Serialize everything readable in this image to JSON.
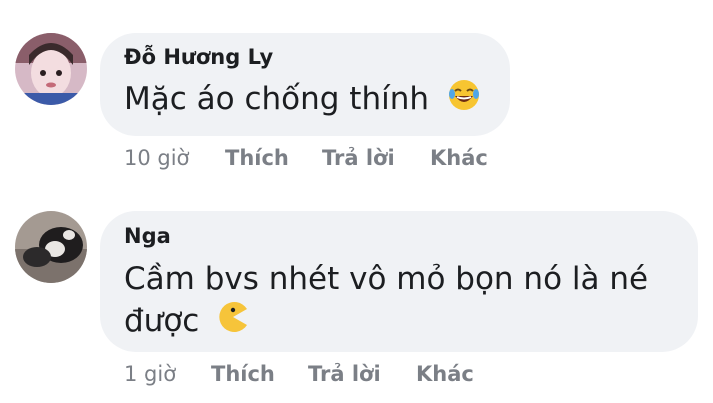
{
  "comments": [
    {
      "author": "Đỗ Hương Ly",
      "text": "Mặc áo chống thính",
      "emoji_icon": "laughing-tears-emoji",
      "time": "10 giờ",
      "like": "Thích",
      "reply": "Trả lời",
      "more": "Khác"
    },
    {
      "author": "Nga",
      "text_line1": "Cầm bvs nhét vô mỏ bọn nó là né",
      "text_line2": "được",
      "emoji_icon": "pacman-emoji",
      "time": "1 giờ",
      "like": "Thích",
      "reply": "Trả lời",
      "more": "Khác"
    }
  ],
  "colors": {
    "bubble": "#f0f2f5",
    "text": "#1c1e21",
    "meta": "#7b7f86"
  }
}
